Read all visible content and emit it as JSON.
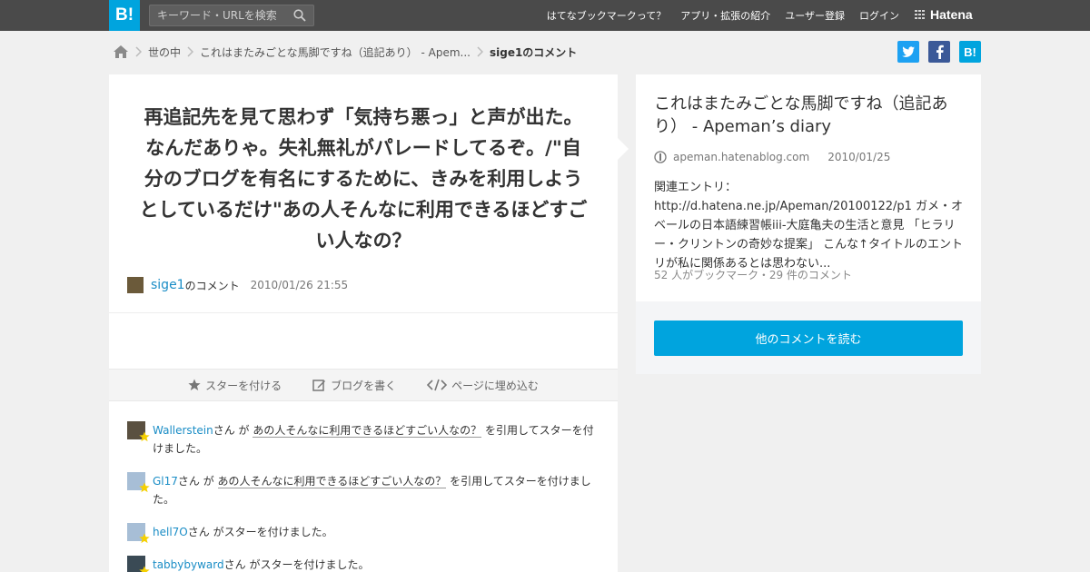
{
  "header": {
    "logo": "B!",
    "search_placeholder": "キーワード・URLを検索",
    "nav": [
      "はてなブックマークって？",
      "アプリ・拡張の紹介",
      "ユーザー登録",
      "ログイン"
    ],
    "brand": "Hatena"
  },
  "breadcrumb": {
    "home_icon": "home-icon",
    "items": [
      "世の中",
      "これはまたみごとな馬脚ですね（追記あり） - Apem...",
      "sige1のコメント"
    ]
  },
  "social": {
    "twitter": "twitter-icon",
    "facebook": "facebook-icon",
    "hatena": "B!"
  },
  "comment": {
    "text": "再追記先を見て思わず「気持ち悪っ」と声が出た。なんだありゃ。失礼無礼がパレードしてるぞ。/\"自分のブログを有名にするために、きみを利用しようとしているだけ\"あの人そんなに利用できるほどすごい人なの？",
    "user": "sige1",
    "user_suffix": "のコメント",
    "date": "2010/01/26 21:55"
  },
  "actions": [
    "スターを付ける",
    "ブログを書く",
    "ページに埋め込む"
  ],
  "stars": [
    {
      "user": "Wallerstein",
      "mid": "さん が ",
      "quote": "あの人そんなに利用できるほどすごい人なの？",
      "tail": " を引用してスターを付けました。"
    },
    {
      "user": "Gl17",
      "mid": "さん が ",
      "quote": "あの人そんなに利用できるほどすごい人なの？",
      "tail": " を引用してスターを付けました。"
    },
    {
      "user": "hell7O",
      "mid": "さん がスターを付けました。",
      "quote": "",
      "tail": ""
    },
    {
      "user": "tabbybyward",
      "mid": "さん がスターを付けました。",
      "quote": "",
      "tail": ""
    }
  ],
  "entry": {
    "title": "これはまたみごとな馬脚ですね（追記あり） - Apeman’s diary",
    "site": "apeman.hatenablog.com",
    "date": "2010/01/25",
    "summary": "関連エントリ：http://d.hatena.ne.jp/Apeman/20100122/p1 ガメ・オベールの日本語練習帳iii-大庭亀夫の生活と意見 「ヒラリー・クリントンの奇妙な提案」 こんな↑タイトルのエントリが私に関係あるとは思わない...",
    "counts": "52 人がブックマーク・29 件のコメント",
    "read_more": "他のコメントを読む"
  },
  "colors": {
    "topbar": "#4a4a4a",
    "accent": "#00a4de",
    "link": "#1a8dc6",
    "twitter": "#1da1f2",
    "facebook": "#3b5998"
  }
}
